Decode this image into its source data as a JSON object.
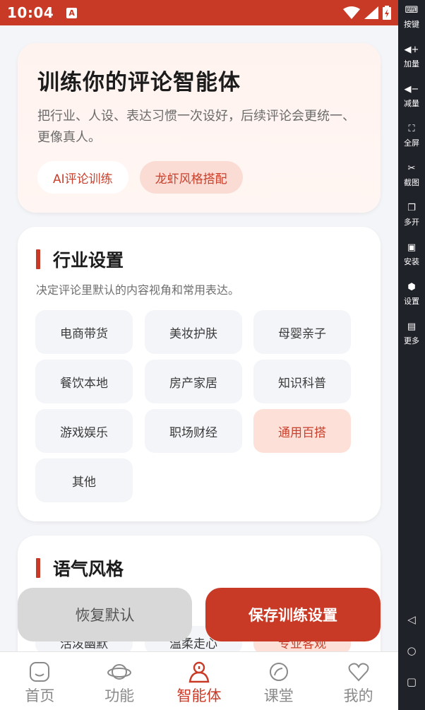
{
  "status": {
    "time": "10:04",
    "a_badge": "A"
  },
  "tools": [
    {
      "label": "按键",
      "icon": "keyboard-icon"
    },
    {
      "label": "加量",
      "icon": "volume-up-icon"
    },
    {
      "label": "减量",
      "icon": "volume-down-icon"
    },
    {
      "label": "全屏",
      "icon": "fullscreen-icon"
    },
    {
      "label": "截图",
      "icon": "scissors-icon"
    },
    {
      "label": "多开",
      "icon": "multi-window-icon"
    },
    {
      "label": "安装",
      "icon": "apk-icon"
    },
    {
      "label": "设置",
      "icon": "gear-icon"
    },
    {
      "label": "更多",
      "icon": "more-icon"
    }
  ],
  "hero": {
    "title": "训练你的评论智能体",
    "subtitle": "把行业、人设、表达习惯一次设好，后续评论会更统一、更像真人。",
    "chip1": "AI评论训练",
    "chip2": "龙虾风格搭配"
  },
  "industry": {
    "title": "行业设置",
    "desc": "决定评论里默认的内容视角和常用表达。",
    "options": [
      "电商带货",
      "美妆护肤",
      "母婴亲子",
      "餐饮本地",
      "房产家居",
      "知识科普",
      "游戏娱乐",
      "职场财经",
      "通用百搭",
      "其他"
    ],
    "selected": "通用百搭"
  },
  "tone": {
    "title": "语气风格",
    "options": [
      "活泼幽默",
      "温柔走心",
      "专业客观"
    ],
    "selected": "专业客观"
  },
  "actions": {
    "reset": "恢复默认",
    "save": "保存训练设置"
  },
  "nav": [
    {
      "label": "首页",
      "icon": "home-icon"
    },
    {
      "label": "功能",
      "icon": "planet-icon"
    },
    {
      "label": "智能体",
      "icon": "agent-icon"
    },
    {
      "label": "课堂",
      "icon": "class-icon"
    },
    {
      "label": "我的",
      "icon": "heart-icon"
    }
  ],
  "nav_active": "智能体",
  "colors": {
    "brand": "#c93a26",
    "chip_pink": "#fbdcd4",
    "selected_bg": "#fde1d8"
  }
}
